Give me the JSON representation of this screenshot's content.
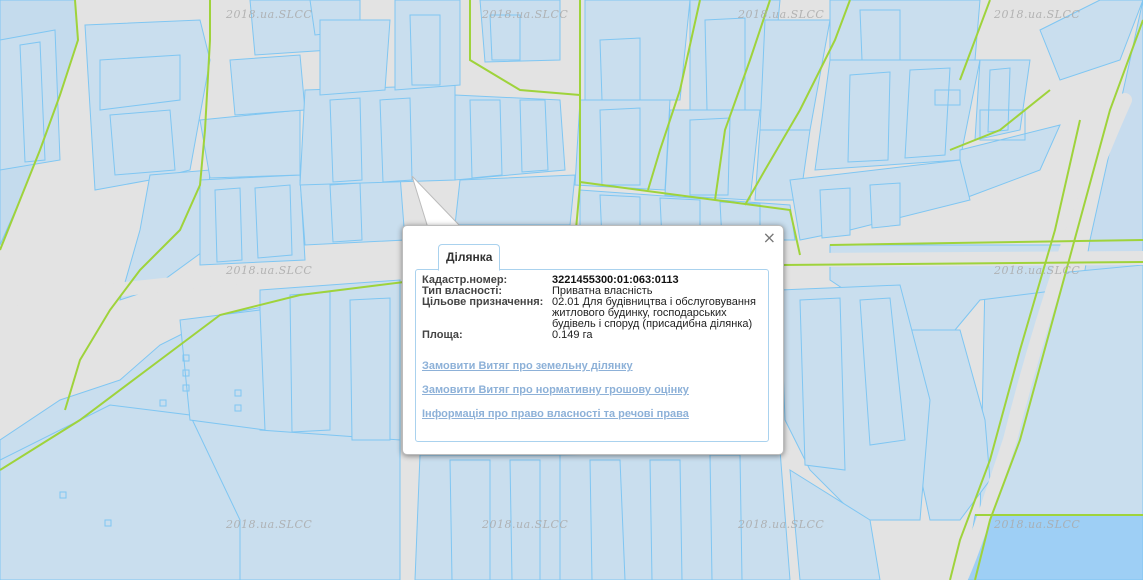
{
  "map": {
    "watermark": "2018.ua.SLCC",
    "colors": {
      "background": "#e3e3e3",
      "parcel_fill": "#c9deee",
      "parcel_stroke": "#7fc6f2",
      "boundary": "#9fd33b"
    }
  },
  "popup": {
    "tab_label": "Ділянка",
    "close_symbol": "×",
    "fields": [
      {
        "label": "Кадастр.номер:",
        "value": "3221455300:01:063:0113"
      },
      {
        "label": "Тип власності:",
        "value": "Приватна власність"
      },
      {
        "label": "Цільове призначення:",
        "value": "02.01 Для будівництва і обслуговування житлового будинку, господарських будівель і споруд (присадибна ділянка)"
      },
      {
        "label": "Площа:",
        "value": "0.149 га"
      }
    ],
    "links": [
      "Замовити Витяг про земельну ділянку",
      "Замовити Витяг про нормативну грошову оцінку",
      "Інформація про право власності та речові права"
    ]
  }
}
